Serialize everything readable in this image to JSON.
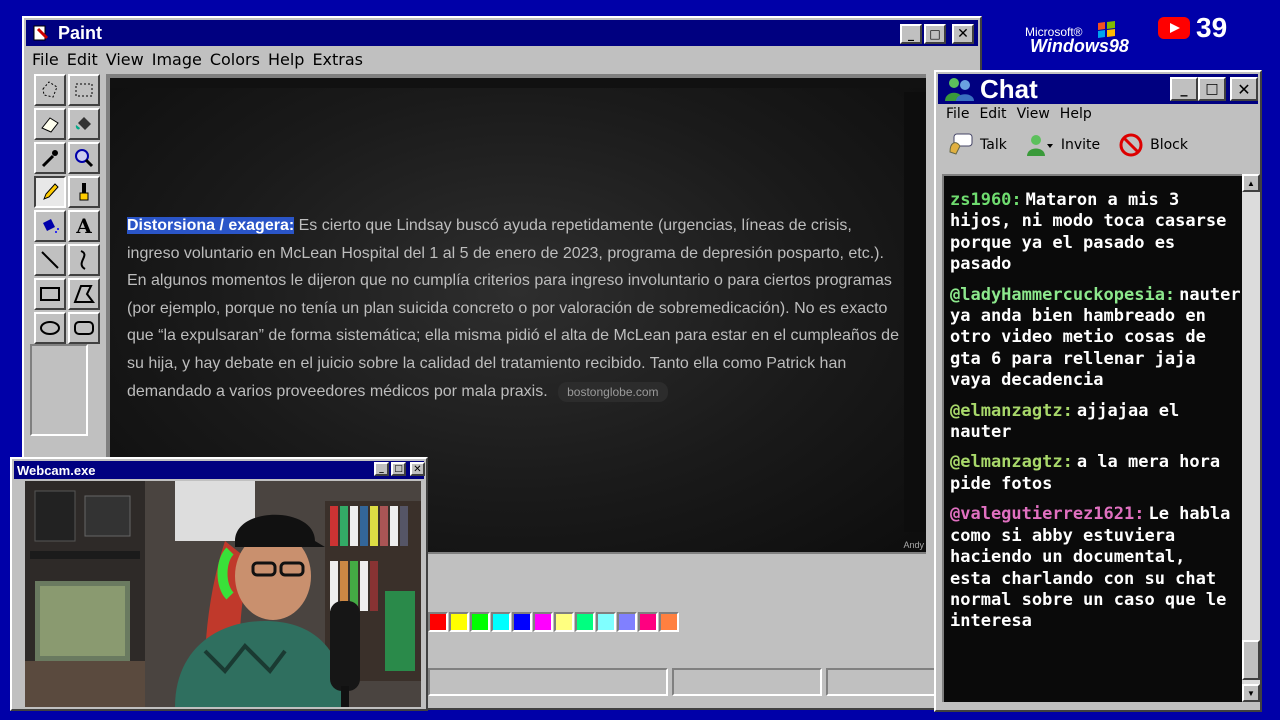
{
  "logo": {
    "microsoft": "Microsoft®",
    "windows": "Windows98"
  },
  "youtube": {
    "count": "39"
  },
  "paint": {
    "title": "Paint",
    "menu": [
      "File",
      "Edit",
      "View",
      "Image",
      "Colors",
      "Help",
      "Extras"
    ],
    "canvas": {
      "highlight": "Distorsiona / exagera:",
      "body": " Es cierto que Lindsay buscó ayuda repetidamente (urgencias, líneas de crisis, ingreso voluntario en McLean Hospital del 1 al 5 de enero de 2023, programa de depresión posparto, etc.). En algunos momentos le dijeron que no cumplía criterios para ingreso involuntario o para ciertos programas (por ejemplo, porque no tenía un plan suicida concreto o por valoración de sobremedicación). No es exacto que “la expulsaran” de forma sistemática; ella misma pidió el alta de McLean para estar en el cumpleaños de su hija, y hay debate en el juicio sobre la calidad del tratamiento recibido. Tanto ella como Patrick han demandado a varios proveedores médicos por mala praxis.",
      "source": "bostonglobe.com",
      "corner": "Andy"
    },
    "palette": [
      "#ff0000",
      "#ffff00",
      "#00ff00",
      "#00ffff",
      "#0000ff",
      "#ff00ff",
      "#ffff80",
      "#00ff80",
      "#80ffff",
      "#8080ff",
      "#ff0080",
      "#ff8040"
    ]
  },
  "chat": {
    "title": "Chat",
    "menu": [
      "File",
      "Edit",
      "View",
      "Help"
    ],
    "toolbar": {
      "talk": "Talk",
      "invite": "Invite",
      "block": "Block"
    },
    "messages": [
      {
        "user": "zs1960:",
        "color": "#6fdc6f",
        "text": "Mataron a mis 3 hijos, ni modo toca casarse porque ya el pasado es pasado"
      },
      {
        "user": "@ladyHammercuckopesia:",
        "color": "#8ce88c",
        "text": "nauter ya anda bien hambreado en otro video metio cosas de gta 6 para rellenar jaja vaya decadencia"
      },
      {
        "user": "@elmanzagtz:",
        "color": "#a8d86a",
        "text": "ajjajaa el nauter"
      },
      {
        "user": "@elmanzagtz:",
        "color": "#a8d86a",
        "text": "a la mera hora pide fotos"
      },
      {
        "user": "@valegutierrez1621:",
        "color": "#e070c0",
        "text": "Le habla como si abby estuviera haciendo un documental, esta charlando con su chat normal sobre un caso que le interesa"
      }
    ]
  },
  "webcam": {
    "title": "Webcam.exe"
  }
}
